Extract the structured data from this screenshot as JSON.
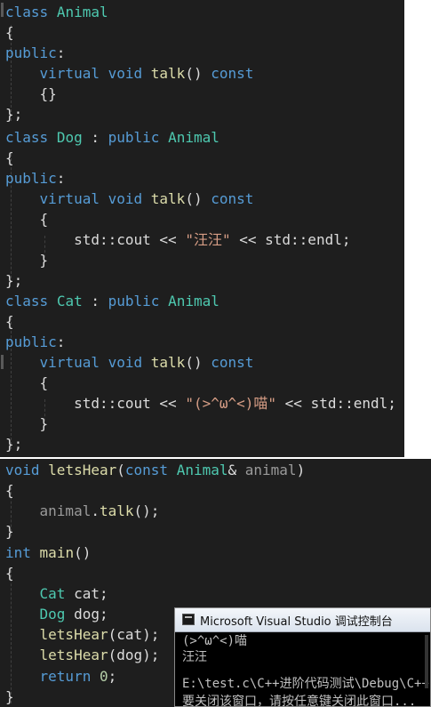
{
  "animal": {
    "l1": {
      "kw": "class",
      "name": "Animal"
    },
    "l2": "{",
    "l3": {
      "kw": "public",
      "colon": ":"
    },
    "l4": {
      "virtual": "virtual",
      "void": "void",
      "fn": "talk",
      "parens": "()",
      "const": "const"
    },
    "l5": "{}",
    "l6": "};"
  },
  "dog": {
    "l1": {
      "kw": "class",
      "name": "Dog",
      "colon": ":",
      "pub": "public",
      "base": "Animal"
    },
    "l2": "{",
    "l3": {
      "kw": "public",
      "colon": ":"
    },
    "l4": {
      "virtual": "virtual",
      "void": "void",
      "fn": "talk",
      "parens": "()",
      "const": "const"
    },
    "l5": "{",
    "l6": {
      "cout": "std::cout",
      "op1": "<<",
      "str": "\"汪汪\"",
      "op2": "<<",
      "endl": "std::endl;"
    },
    "l7": "}",
    "l8": "};"
  },
  "cat": {
    "l1": {
      "kw": "class",
      "name": "Cat",
      "colon": ":",
      "pub": "public",
      "base": "Animal"
    },
    "l2": "{",
    "l3": {
      "kw": "public",
      "colon": ":"
    },
    "l4": {
      "virtual": "virtual",
      "void": "void",
      "fn": "talk",
      "parens": "()",
      "const": "const"
    },
    "l5": "{",
    "l6": {
      "cout": "std::cout",
      "op1": "<<",
      "str": "\"(>^ω^<)喵\"",
      "op2": "<<",
      "endl": "std::endl;"
    },
    "l7": "}",
    "l8": "};"
  },
  "main_code": {
    "l1": {
      "void": "void",
      "fn": "letsHear",
      "open": "(",
      "const": "const",
      "type": "Animal",
      "amp": "&",
      "param": "animal",
      "close": ")"
    },
    "l2": "{",
    "l3": {
      "obj": "animal",
      "dot": ".",
      "fn": "talk",
      "rest": "();"
    },
    "l4": "}",
    "l5": {
      "int": "int",
      "fn": "main",
      "parens": "()"
    },
    "l6": "{",
    "l7": {
      "type": "Cat",
      "var": "cat;"
    },
    "l8": {
      "type": "Dog",
      "var": "dog;"
    },
    "l9": {
      "fn": "letsHear",
      "rest": "(cat);"
    },
    "l10": {
      "fn": "letsHear",
      "rest": "(dog);"
    },
    "l11": {
      "kw": "return",
      "num": "0",
      "semi": ";"
    },
    "l12": "}"
  },
  "console": {
    "title": "Microsoft Visual Studio 调试控制台",
    "lines": [
      "(>^ω^<)喵",
      "汪汪",
      "",
      "E:\\test.c\\C++进阶代码测试\\Debug\\C++",
      "要关闭该窗口，请按任意键关闭此窗口..."
    ]
  },
  "colors": {
    "editor_bg": "#1e1e1e",
    "keyword": "#569cd6",
    "type": "#4ec9b0",
    "function": "#dcdcaa",
    "string": "#d69d85",
    "number": "#b5cea8",
    "console_bg": "#000000"
  }
}
